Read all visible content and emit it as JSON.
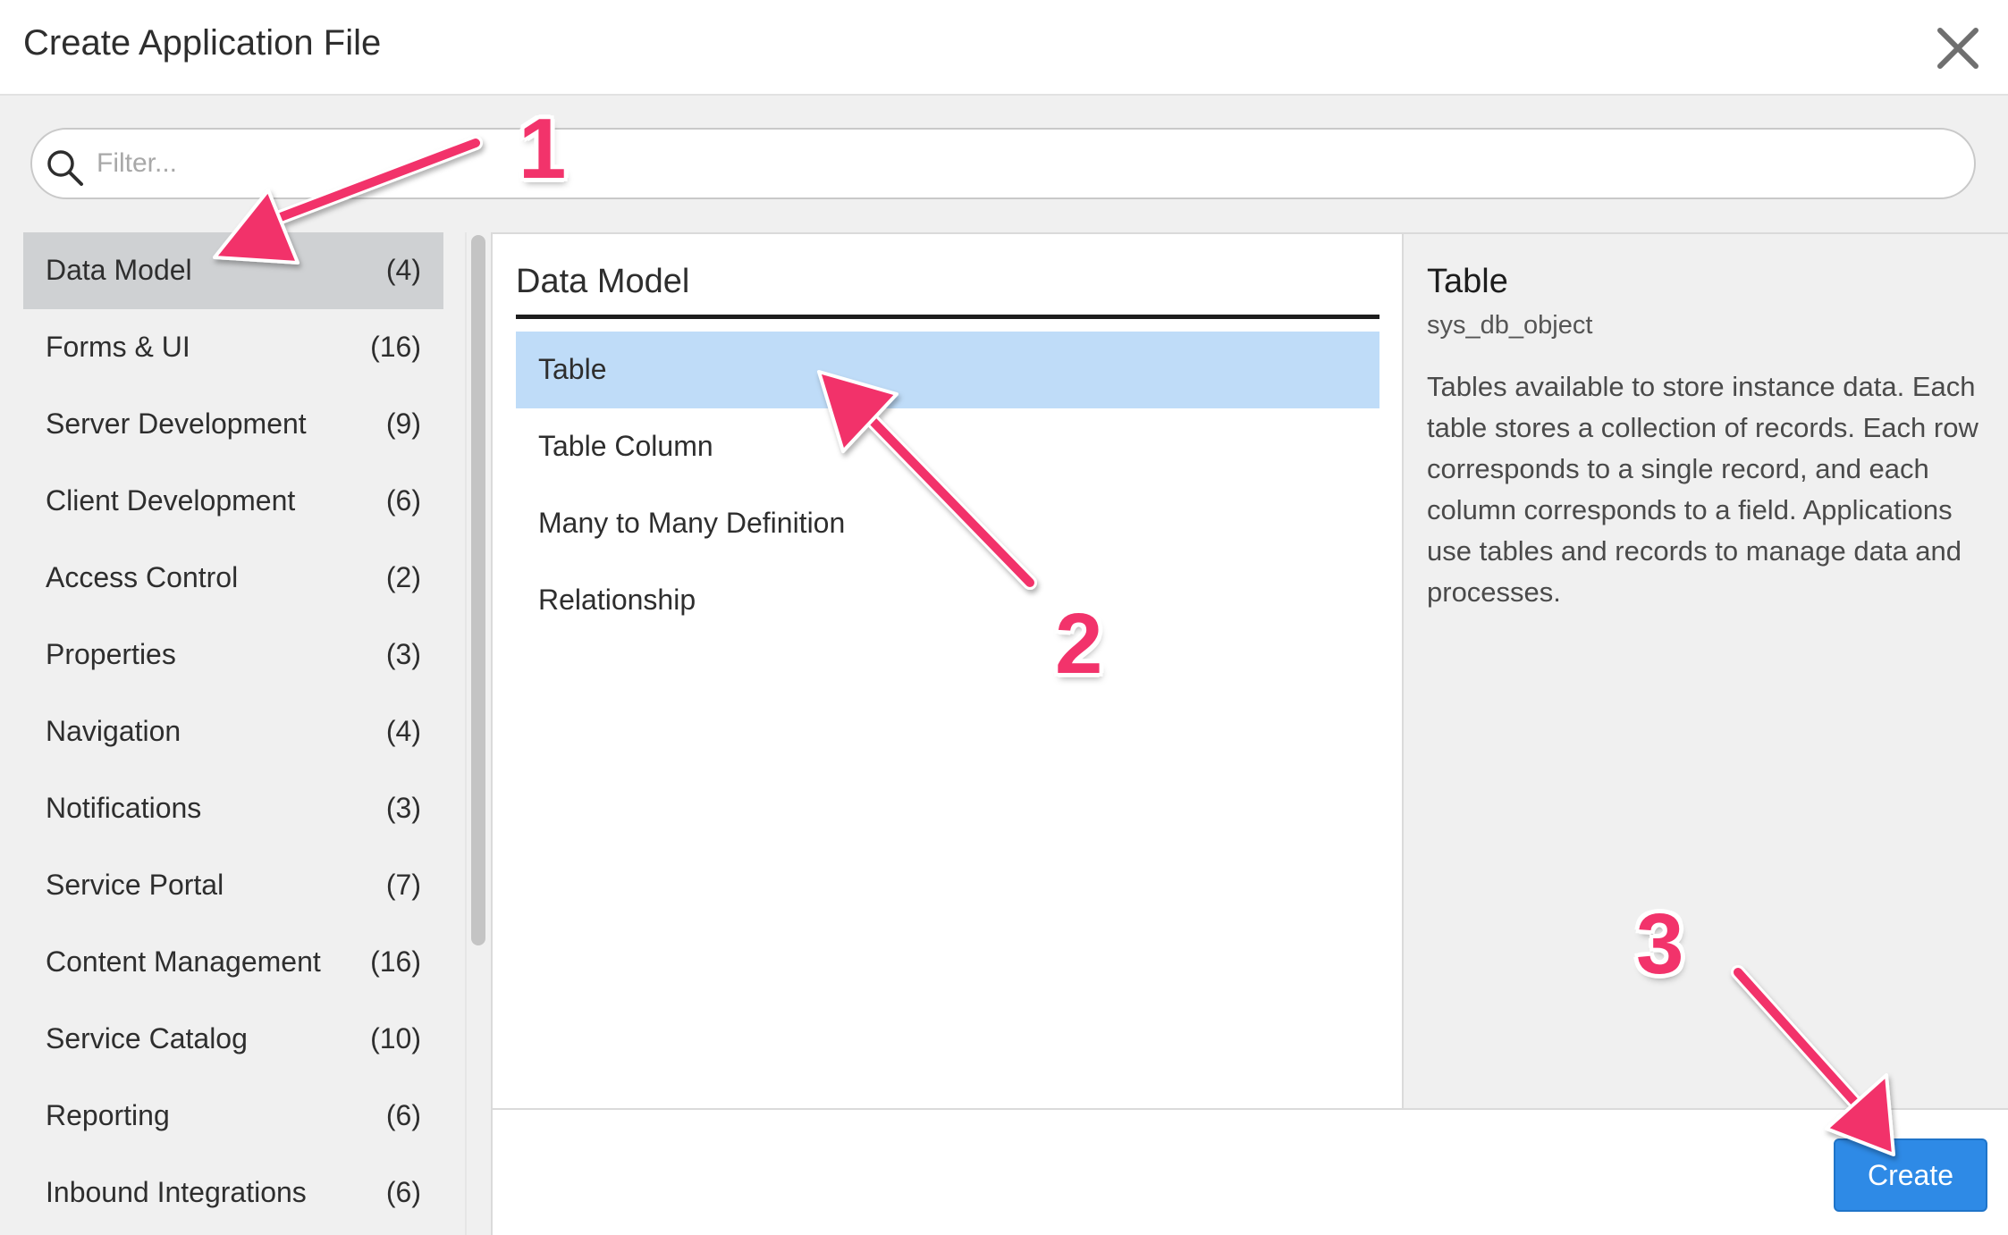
{
  "dialog": {
    "title": "Create Application File"
  },
  "filter": {
    "placeholder": "Filter...",
    "value": ""
  },
  "sidebar": {
    "items": [
      {
        "label": "Data Model",
        "count": "(4)",
        "active": true
      },
      {
        "label": "Forms & UI",
        "count": "(16)"
      },
      {
        "label": "Server Development",
        "count": "(9)"
      },
      {
        "label": "Client Development",
        "count": "(6)"
      },
      {
        "label": "Access Control",
        "count": "(2)"
      },
      {
        "label": "Properties",
        "count": "(3)"
      },
      {
        "label": "Navigation",
        "count": "(4)"
      },
      {
        "label": "Notifications",
        "count": "(3)"
      },
      {
        "label": "Service Portal",
        "count": "(7)"
      },
      {
        "label": "Content Management",
        "count": "(16)"
      },
      {
        "label": "Service Catalog",
        "count": "(10)"
      },
      {
        "label": "Reporting",
        "count": "(6)"
      },
      {
        "label": "Inbound Integrations",
        "count": "(6)"
      }
    ]
  },
  "list": {
    "title": "Data Model",
    "items": [
      {
        "label": "Table",
        "selected": true
      },
      {
        "label": "Table Column"
      },
      {
        "label": "Many to Many Definition"
      },
      {
        "label": "Relationship"
      }
    ]
  },
  "detail": {
    "title": "Table",
    "table_name": "sys_db_object",
    "description": "Tables available to store instance data. Each table stores a collection of records. Each row corresponds to a single record, and each column corresponds to a field. Applications use tables and records to manage data and processes."
  },
  "footer": {
    "create_label": "Create"
  },
  "annotations": {
    "steps": [
      "1",
      "2",
      "3"
    ],
    "color": "#f2336b"
  },
  "colors": {
    "selected_row": "#bfdcf8",
    "active_category": "#cfd1d3",
    "primary_button": "#2e8ae6"
  }
}
